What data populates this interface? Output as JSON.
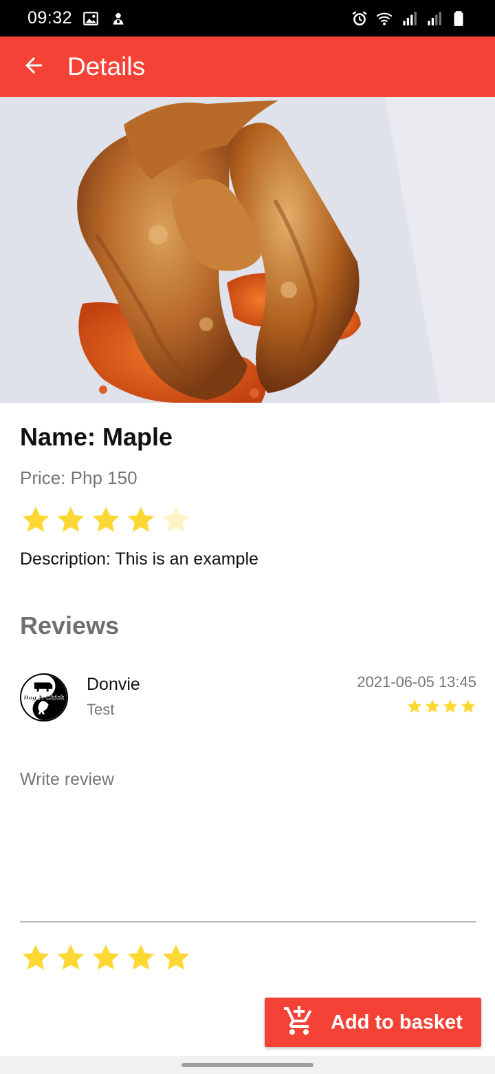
{
  "status_bar": {
    "time": "09:32",
    "left_icons": [
      "image-icon",
      "notification-icon"
    ],
    "right_icons": [
      "alarm-icon",
      "wifi-icon",
      "signal-icon",
      "signal-icon",
      "battery-icon"
    ]
  },
  "app_bar": {
    "title": "Details",
    "back_icon": "arrow-back-icon",
    "color": "#f44336"
  },
  "product": {
    "image": "fried chicken wings with sauce",
    "name": "Name: Maple",
    "price": "Price: Php 150",
    "rating": 4.5,
    "rating_max": 5,
    "description": "Description: This is an example"
  },
  "reviews": {
    "heading": "Reviews",
    "items": [
      {
        "name": "Donvie",
        "text": "Test",
        "date": "2021-06-05 13:45",
        "rating": 4,
        "avatar_text": "Bag N Chick"
      }
    ]
  },
  "write_review": {
    "placeholder": "Write review",
    "rating": 5
  },
  "add_to_basket": {
    "label": "Add to basket",
    "icon": "add-shopping-cart-icon"
  },
  "colors": {
    "primary": "#f44336",
    "star": "#fdd835",
    "muted_text": "#757575"
  }
}
